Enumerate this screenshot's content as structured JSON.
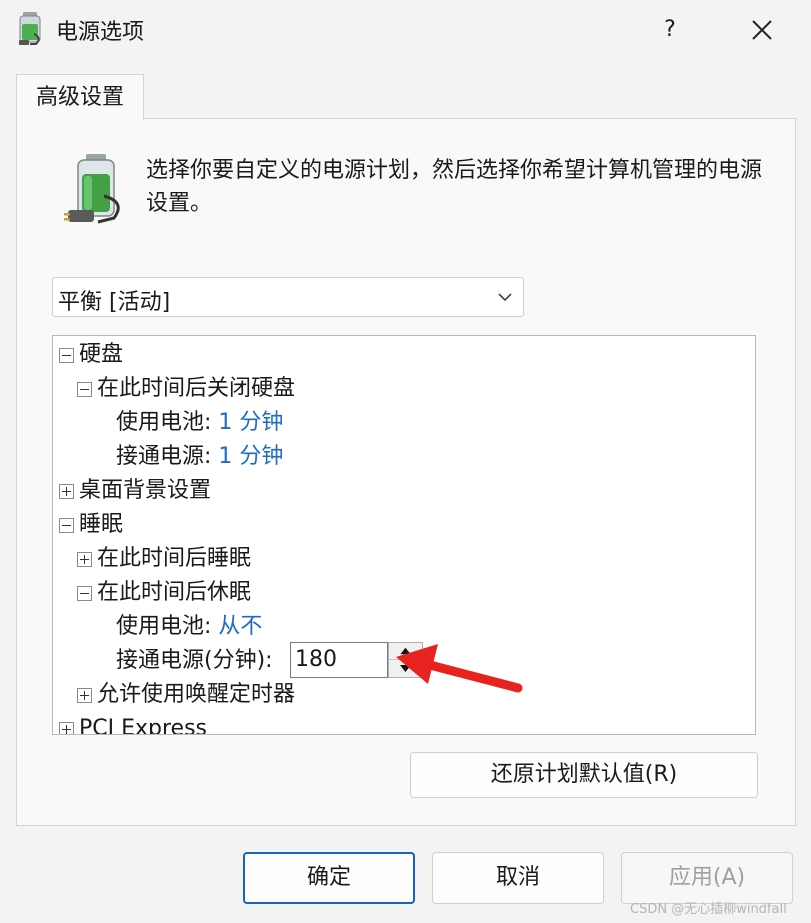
{
  "window": {
    "title": "电源选项",
    "help": "?"
  },
  "tab": {
    "label": "高级设置"
  },
  "description": "选择你要自定义的电源计划，然后选择你希望计算机管理的电源设置。",
  "plan_select": {
    "value": "平衡 [活动]"
  },
  "tree": {
    "hard_disk": "硬盘",
    "turn_off_disk": "在此时间后关闭硬盘",
    "battery_label_1": "使用电池:",
    "battery_value_1": "1 分钟",
    "plugged_label_1": "接通电源:",
    "plugged_value_1": "1 分钟",
    "desktop_bg": "桌面背景设置",
    "sleep": "睡眠",
    "sleep_after": "在此时间后睡眠",
    "hibernate_after": "在此时间后休眠",
    "battery_label_2": "使用电池:",
    "battery_value_2": "从不",
    "plugged_label_2": "接通电源(分钟):",
    "plugged_value_2": "180",
    "wake_timers": "允许使用唤醒定时器",
    "pci": "PCI Express"
  },
  "buttons": {
    "restore": "还原计划默认值(R)",
    "ok": "确定",
    "cancel": "取消",
    "apply": "应用(A)"
  },
  "watermark": "CSDN @无心插柳windfall",
  "colors": {
    "link_value": "#1c6cc8",
    "accent": "#1565c0",
    "arrow": "#e8231f"
  }
}
